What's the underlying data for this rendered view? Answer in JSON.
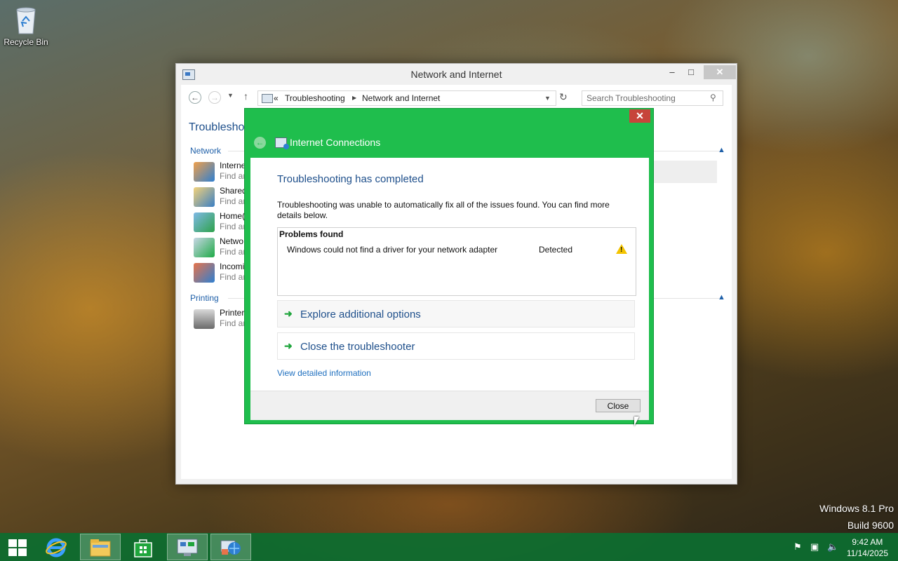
{
  "desktop": {
    "recycle_bin_label": "Recycle Bin",
    "watermark_line1": "Windows 8.1 Pro",
    "watermark_line2": "Build 9600"
  },
  "window": {
    "title": "Network and Internet",
    "address": {
      "prefix": "«",
      "crumbs": [
        "Troubleshooting",
        "Network and Internet"
      ]
    },
    "search_placeholder": "Search Troubleshooting",
    "page_title_partial": "Troublesho",
    "sections": [
      {
        "label": "Network",
        "items": [
          {
            "title": "Interne",
            "desc": "Find ar"
          },
          {
            "title": "Shared",
            "desc": "Find ar"
          },
          {
            "title": "Home(",
            "desc": "Find ar"
          },
          {
            "title": "Netwo",
            "desc": "Find ar"
          },
          {
            "title": "Incomi",
            "desc": "Find ar"
          }
        ]
      },
      {
        "label": "Printing",
        "items": [
          {
            "title": "Printer",
            "desc": "Find ar"
          }
        ]
      }
    ]
  },
  "dialog": {
    "title": "Internet Connections",
    "heading": "Troubleshooting has completed",
    "message": "Troubleshooting was unable to automatically fix all of the issues found. You can find more details below.",
    "problems_header": "Problems found",
    "problems": [
      {
        "text": "Windows could not find a driver for your network adapter",
        "status": "Detected"
      }
    ],
    "options": [
      "Explore additional options",
      "Close the troubleshooter"
    ],
    "detail_link": "View detailed information",
    "close_button": "Close",
    "accent_color": "#1fbe4d"
  },
  "taskbar": {
    "clock_time": "9:42 AM",
    "clock_date": "11/14/2025",
    "color": "#0c6e30"
  }
}
